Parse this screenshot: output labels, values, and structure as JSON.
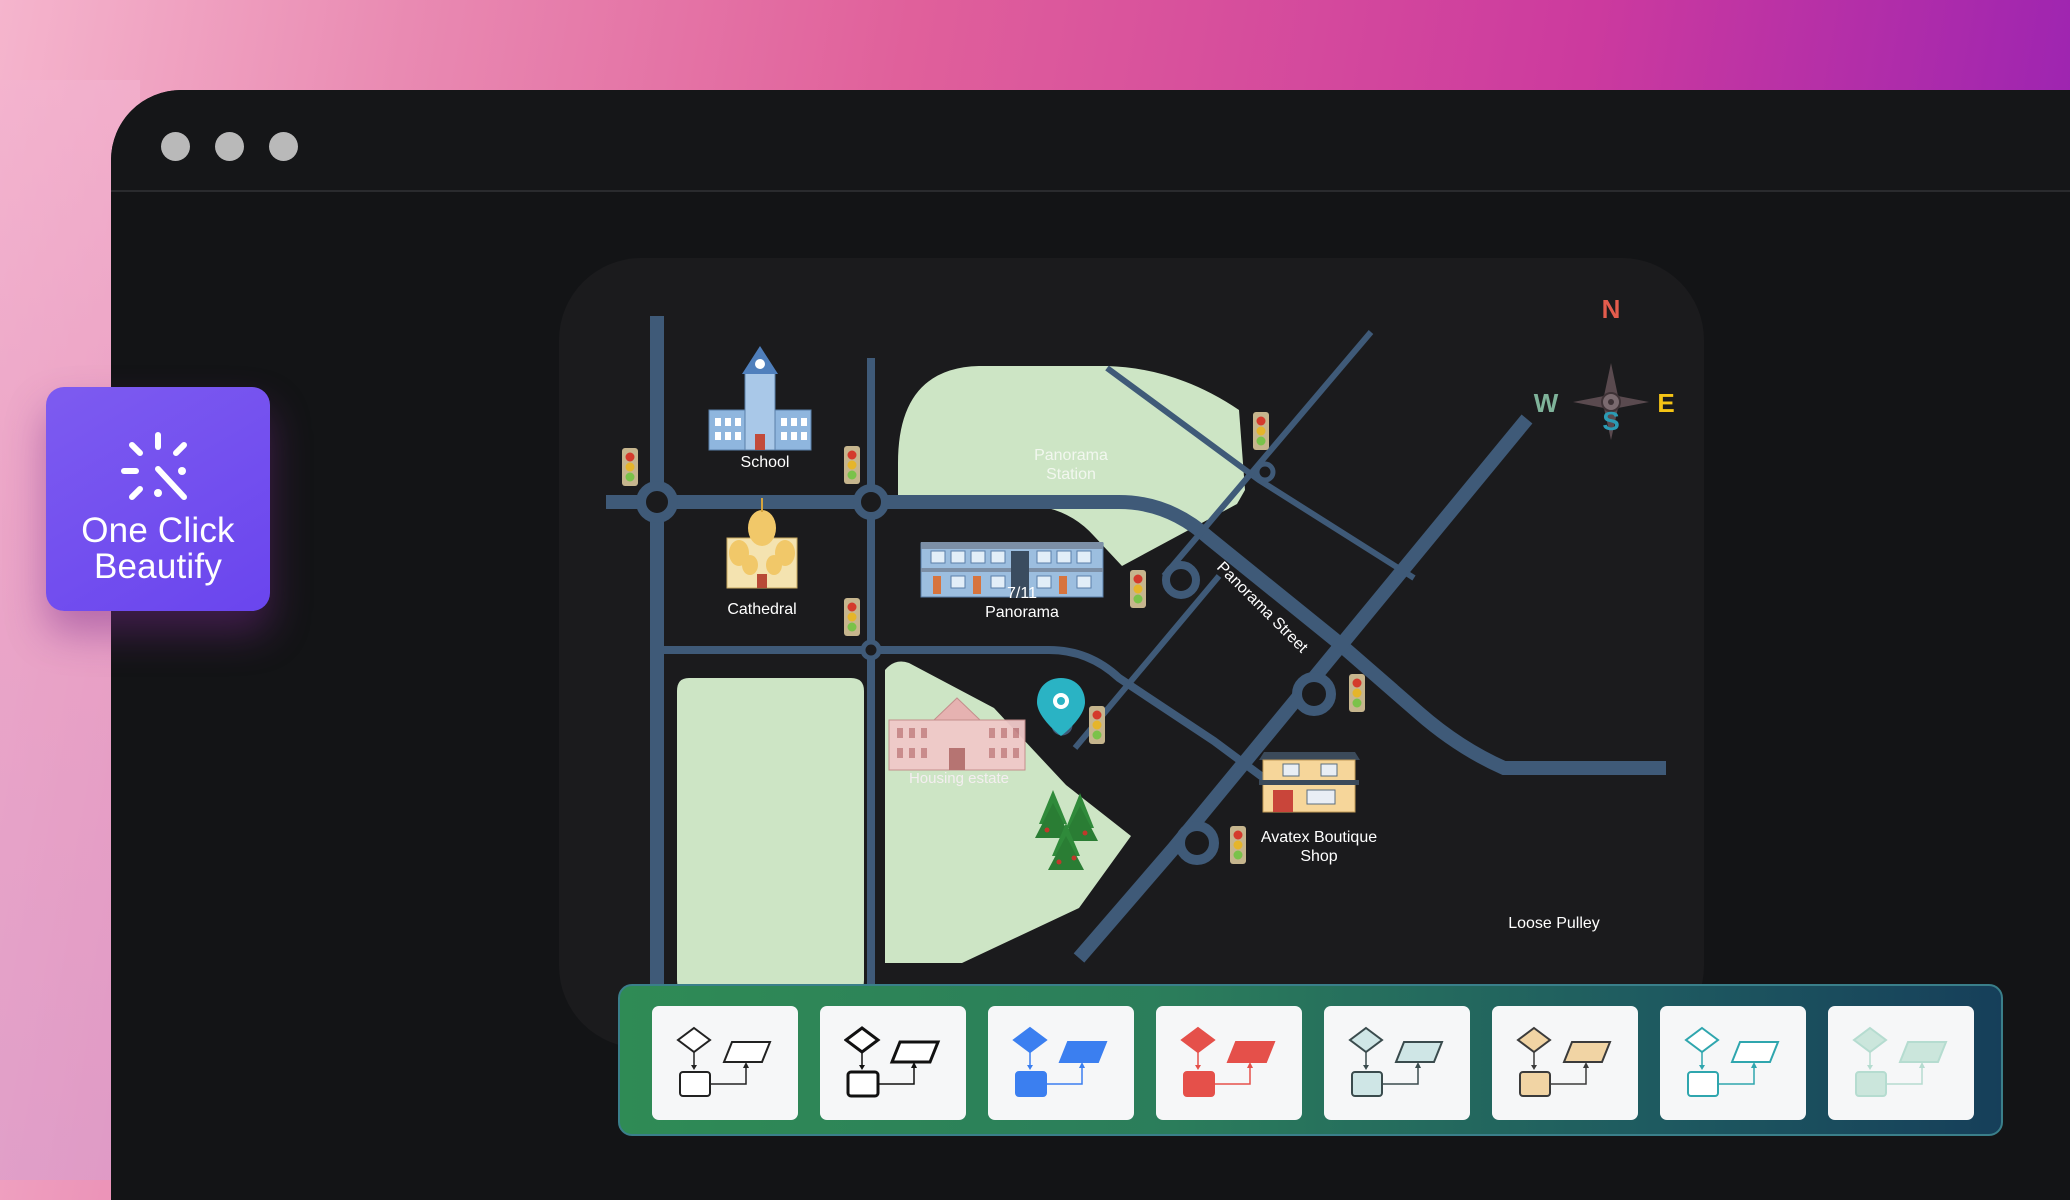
{
  "window": {
    "controls": [
      "window-dot-1",
      "window-dot-2",
      "window-dot-3"
    ]
  },
  "feature_badge": {
    "line1": "One Click",
    "line2": "Beautify",
    "icon": "sparkle-wand-icon",
    "color": "#6f4bef"
  },
  "map": {
    "labels": {
      "school": "School",
      "cathedral": "Cathedral",
      "panorama_station_1": "Panorama",
      "panorama_station_2": "Station",
      "store_1": "7/11",
      "store_2": "Panorama",
      "housing": "Housing estate",
      "street": "Panorama Street",
      "boutique_1": "Avatex Boutique",
      "boutique_2": "Shop",
      "pulley": "Loose Pulley"
    },
    "compass": {
      "n": "N",
      "e": "E",
      "s": "S",
      "w": "W"
    },
    "colors": {
      "road": "#3f5a78",
      "park": "#cde5c5",
      "pin": "#2ab3c4",
      "compass_n": "#e45c4d",
      "compass_e": "#f5c415",
      "compass_s": "#2b9bb4",
      "compass_w": "#7fb39a"
    }
  },
  "theme_toolbar": {
    "themes": [
      {
        "name": "Outline",
        "stroke": "#222222",
        "fill": "#ffffff"
      },
      {
        "name": "Bold Outline",
        "stroke": "#111111",
        "fill": "#ffffff"
      },
      {
        "name": "Blue",
        "stroke": "#3b7ff0",
        "fill": "#3b7ff0"
      },
      {
        "name": "Red",
        "stroke": "#e5504a",
        "fill": "#e5504a"
      },
      {
        "name": "Mint",
        "stroke": "#3a4b4d",
        "fill": "#cfe6e6"
      },
      {
        "name": "Sand",
        "stroke": "#3b3b3b",
        "fill": "#f1d4a4"
      },
      {
        "name": "Teal Line",
        "stroke": "#2fa6ae",
        "fill": "#ffffff"
      },
      {
        "name": "Soft Green",
        "stroke": "#b5dcd0",
        "fill": "#cbe6dc"
      }
    ]
  }
}
